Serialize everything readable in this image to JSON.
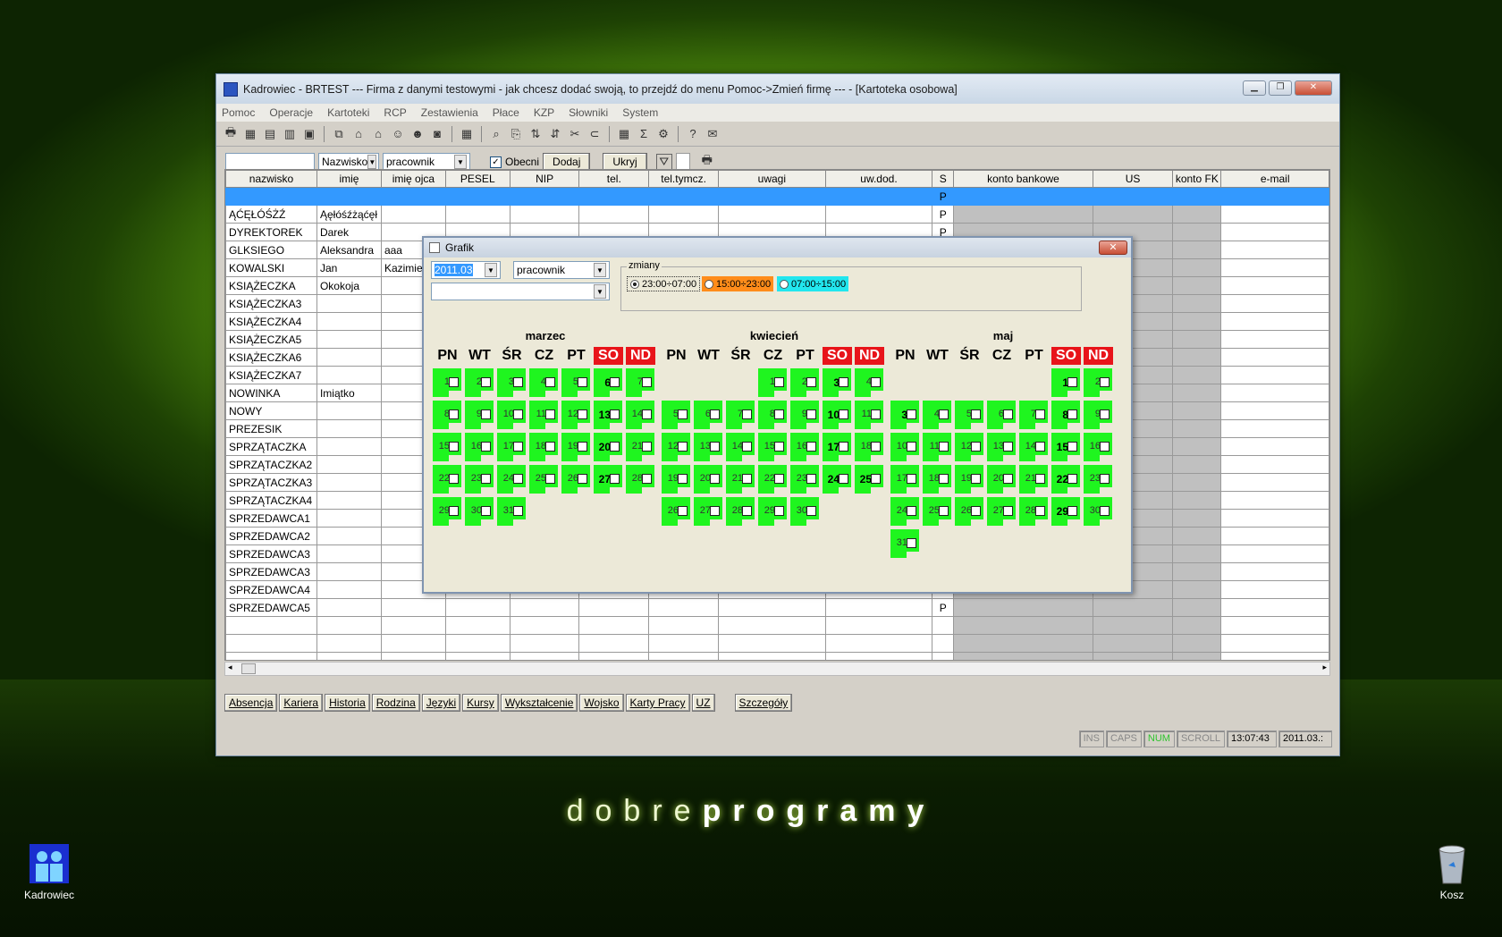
{
  "window": {
    "title": "Kadrowiec - BRTEST    ---  Firma z danymi testowymi - jak chcesz dodać swoją, to przejdź do menu Pomoc->Zmień firmę  --- - [Kartoteka osobowa]"
  },
  "menu": [
    "Pomoc",
    "Operacje",
    "Kartoteki",
    "RCP",
    "Zestawienia",
    "Płace",
    "KZP",
    "Słowniki",
    "System"
  ],
  "filter": {
    "search_value": "",
    "sort_value": "Nazwisko",
    "type_value": "pracownik",
    "obecni_label": "Obecni",
    "dodaj_label": "Dodaj",
    "ukryj_label": "Ukryj"
  },
  "columns": [
    "nazwisko",
    "imię",
    "imię ojca",
    "PESEL",
    "NIP",
    "tel.",
    "tel.tymcz.",
    "uwagi",
    "uw.dod.",
    "S",
    "konto bankowe",
    "US",
    "konto FK",
    "e-mail"
  ],
  "rows": [
    {
      "nazwisko": "",
      "imie": "",
      "ojciec": "",
      "s": "P",
      "selected": true
    },
    {
      "nazwisko": "ĄĆĘŁÓŚŻŹ",
      "imie": "Ąęłóśźżąćęł",
      "ojciec": "",
      "s": "P"
    },
    {
      "nazwisko": "DYREKTOREK",
      "imie": "Darek",
      "ojciec": "",
      "s": "P"
    },
    {
      "nazwisko": "GLKSIEGO",
      "imie": "Aleksandra",
      "ojciec": "aaa",
      "s": ""
    },
    {
      "nazwisko": "KOWALSKI",
      "imie": "Jan",
      "ojciec": "Kazimierz",
      "s": ""
    },
    {
      "nazwisko": "KSIĄŻECZKA",
      "imie": "Okokoja",
      "ojciec": "",
      "s": ""
    },
    {
      "nazwisko": "KSIĄŻECZKA3",
      "imie": "",
      "ojciec": "",
      "s": ""
    },
    {
      "nazwisko": "KSIĄŻECZKA4",
      "imie": "",
      "ojciec": "",
      "s": ""
    },
    {
      "nazwisko": "KSIĄŻECZKA5",
      "imie": "",
      "ojciec": "",
      "s": ""
    },
    {
      "nazwisko": "KSIĄŻECZKA6",
      "imie": "",
      "ojciec": "",
      "s": ""
    },
    {
      "nazwisko": "KSIĄŻECZKA7",
      "imie": "",
      "ojciec": "",
      "s": ""
    },
    {
      "nazwisko": "NOWINKA",
      "imie": "Imiątko",
      "ojciec": "",
      "s": ""
    },
    {
      "nazwisko": "NOWY",
      "imie": "",
      "ojciec": "",
      "s": ""
    },
    {
      "nazwisko": "PREZESIK",
      "imie": "",
      "ojciec": "",
      "s": ""
    },
    {
      "nazwisko": "SPRZĄTACZKA",
      "imie": "",
      "ojciec": "",
      "s": ""
    },
    {
      "nazwisko": "SPRZĄTACZKA2",
      "imie": "",
      "ojciec": "",
      "s": ""
    },
    {
      "nazwisko": "SPRZĄTACZKA3",
      "imie": "",
      "ojciec": "",
      "s": ""
    },
    {
      "nazwisko": "SPRZĄTACZKA4",
      "imie": "",
      "ojciec": "",
      "s": ""
    },
    {
      "nazwisko": "SPRZEDAWCA1",
      "imie": "",
      "ojciec": "",
      "s": ""
    },
    {
      "nazwisko": "SPRZEDAWCA2",
      "imie": "",
      "ojciec": "",
      "s": ""
    },
    {
      "nazwisko": "SPRZEDAWCA3",
      "imie": "",
      "ojciec": "",
      "s": ""
    },
    {
      "nazwisko": "SPRZEDAWCA3",
      "imie": "",
      "ojciec": "",
      "s": ""
    },
    {
      "nazwisko": "SPRZEDAWCA4",
      "imie": "",
      "ojciec": "",
      "s": ""
    },
    {
      "nazwisko": "SPRZEDAWCA5",
      "imie": "",
      "ojciec": "",
      "s": "P"
    }
  ],
  "tabs": [
    "Absencja",
    "Kariera",
    "Historia",
    "Rodzina",
    "Języki",
    "Kursy",
    "Wykształcenie",
    "Wojsko",
    "Karty Pracy",
    "UZ",
    "Szczegóły"
  ],
  "status": {
    "ins": "INS",
    "caps": "CAPS",
    "num": "NUM",
    "scroll": "SCROLL",
    "time": "13:07:43",
    "date": "2011.03.:"
  },
  "dialog": {
    "title": "Grafik",
    "month_value": "2011.03",
    "type_value": "pracownik",
    "second_value": "",
    "zmiany_label": "zmiany",
    "shifts": [
      {
        "label": "23:00÷07:00",
        "color": "#ece9d8",
        "selected": true
      },
      {
        "label": "15:00÷23:00",
        "color": "#ff8c1a",
        "selected": false
      },
      {
        "label": "07:00÷15:00",
        "color": "#22e6ee",
        "selected": false
      }
    ],
    "dow": [
      "PN",
      "WT",
      "ŚR",
      "CZ",
      "PT",
      "SO",
      "ND"
    ],
    "months": [
      {
        "name": "marzec",
        "start": 1,
        "days": 31,
        "bold": [
          6,
          13,
          20,
          27
        ],
        "hide_cb": []
      },
      {
        "name": "kwiecień",
        "start": 4,
        "days": 30,
        "bold": [
          3,
          10,
          17,
          24,
          25
        ],
        "hide_cb": []
      },
      {
        "name": "maj",
        "start": 6,
        "days": 31,
        "bold": [
          1,
          3,
          8,
          15,
          22,
          29
        ],
        "hide_cb": []
      }
    ]
  },
  "desktop": {
    "logo_light": "dobre",
    "logo_bold": "programy",
    "icon1": "Kadrowiec",
    "icon2": "Kosz"
  }
}
